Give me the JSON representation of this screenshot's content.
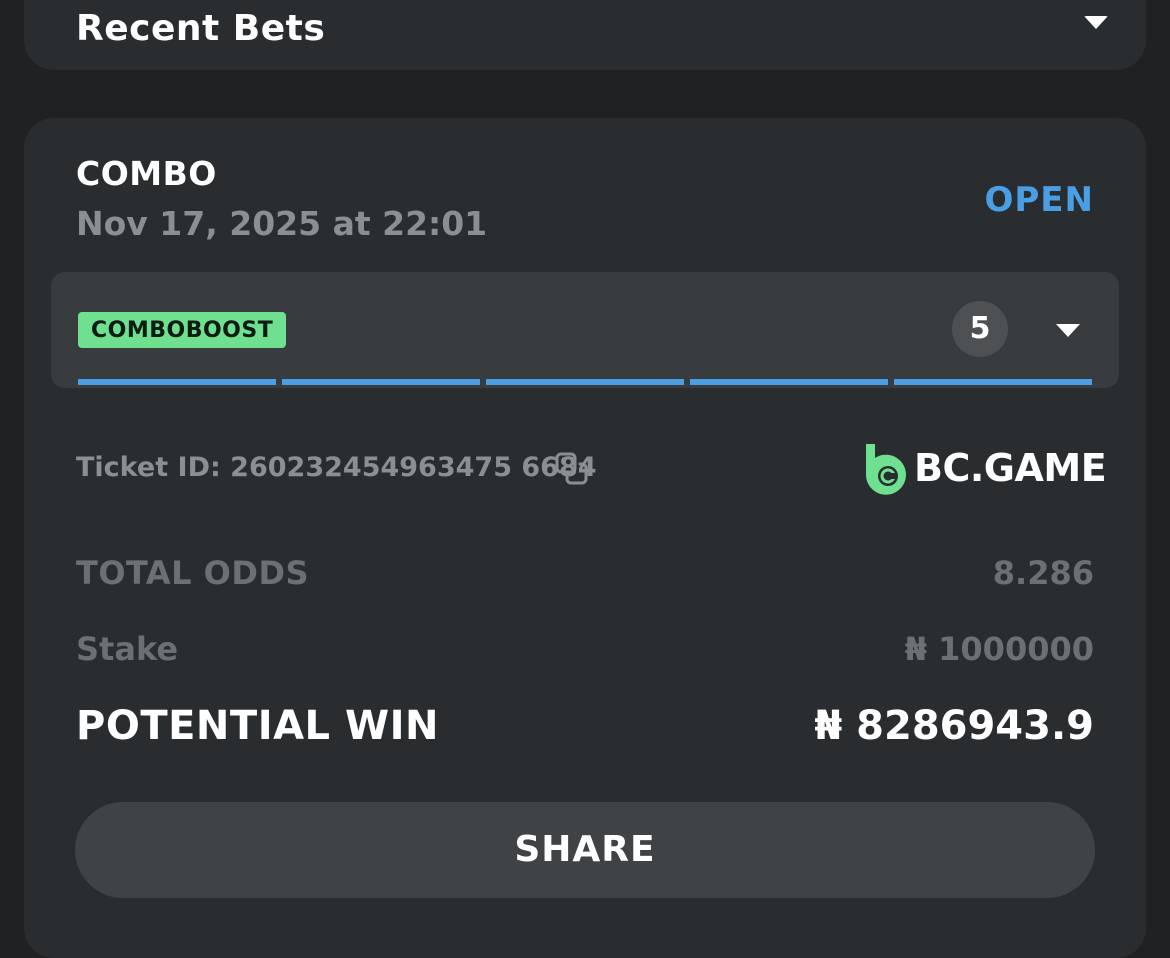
{
  "header": {
    "title": "Recent Bets"
  },
  "bet": {
    "type": "COMBO",
    "date": "Nov 17, 2025 at 22:01",
    "status": "OPEN",
    "boost_label": "COMBOBOOST",
    "selection_count": "5",
    "ticket_id": "Ticket ID: 260232454963475 6684",
    "brand": "BC.GAME",
    "total_odds_label": "TOTAL ODDS",
    "total_odds_value": "8.286",
    "stake_label": "Stake",
    "stake_value": "₦ 1000000",
    "potential_win_label": "POTENTIAL WIN",
    "potential_win_value": "₦ 8286943.9",
    "share_label": "SHARE"
  },
  "colors": {
    "background": "#1f2122",
    "card": "#2a2d2f",
    "panel": "#383c3f",
    "accent_blue": "#4a9fe4",
    "boost_green": "#6ee08f",
    "muted_text": "#8c8f91"
  },
  "icons": [
    "chevron-down-icon",
    "copy-icon",
    "bc-game-logo-icon"
  ]
}
